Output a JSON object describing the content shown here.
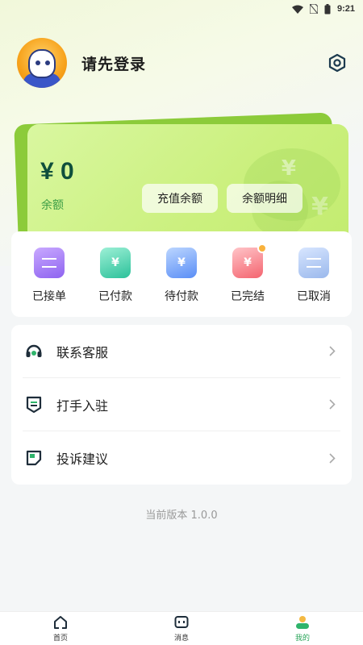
{
  "status_bar": {
    "time": "9:21"
  },
  "profile": {
    "name": "请先登录"
  },
  "wallet": {
    "balance": "¥ 0",
    "balance_label": "余额",
    "recharge_label": "充值余额",
    "detail_label": "余额明细"
  },
  "orders": [
    {
      "label": "已接单",
      "icon": "clipboard-icon"
    },
    {
      "label": "已付款",
      "icon": "wallet-paid-icon"
    },
    {
      "label": "待付款",
      "icon": "pending-payment-icon"
    },
    {
      "label": "已完结",
      "icon": "completed-icon"
    },
    {
      "label": "已取消",
      "icon": "cancelled-icon"
    }
  ],
  "menu": [
    {
      "label": "联系客服",
      "icon": "headset-icon"
    },
    {
      "label": "打手入驻",
      "icon": "badge-icon"
    },
    {
      "label": "投诉建议",
      "icon": "note-icon"
    }
  ],
  "version": "当前版本 1.0.0",
  "tabs": [
    {
      "label": "首页",
      "icon": "home-icon"
    },
    {
      "label": "消息",
      "icon": "message-icon"
    },
    {
      "label": "我的",
      "icon": "profile-icon",
      "active": true
    }
  ],
  "colors": {
    "accent": "#2aa55a",
    "card": "#cbf07e",
    "balance_text": "#0f4f3c"
  }
}
